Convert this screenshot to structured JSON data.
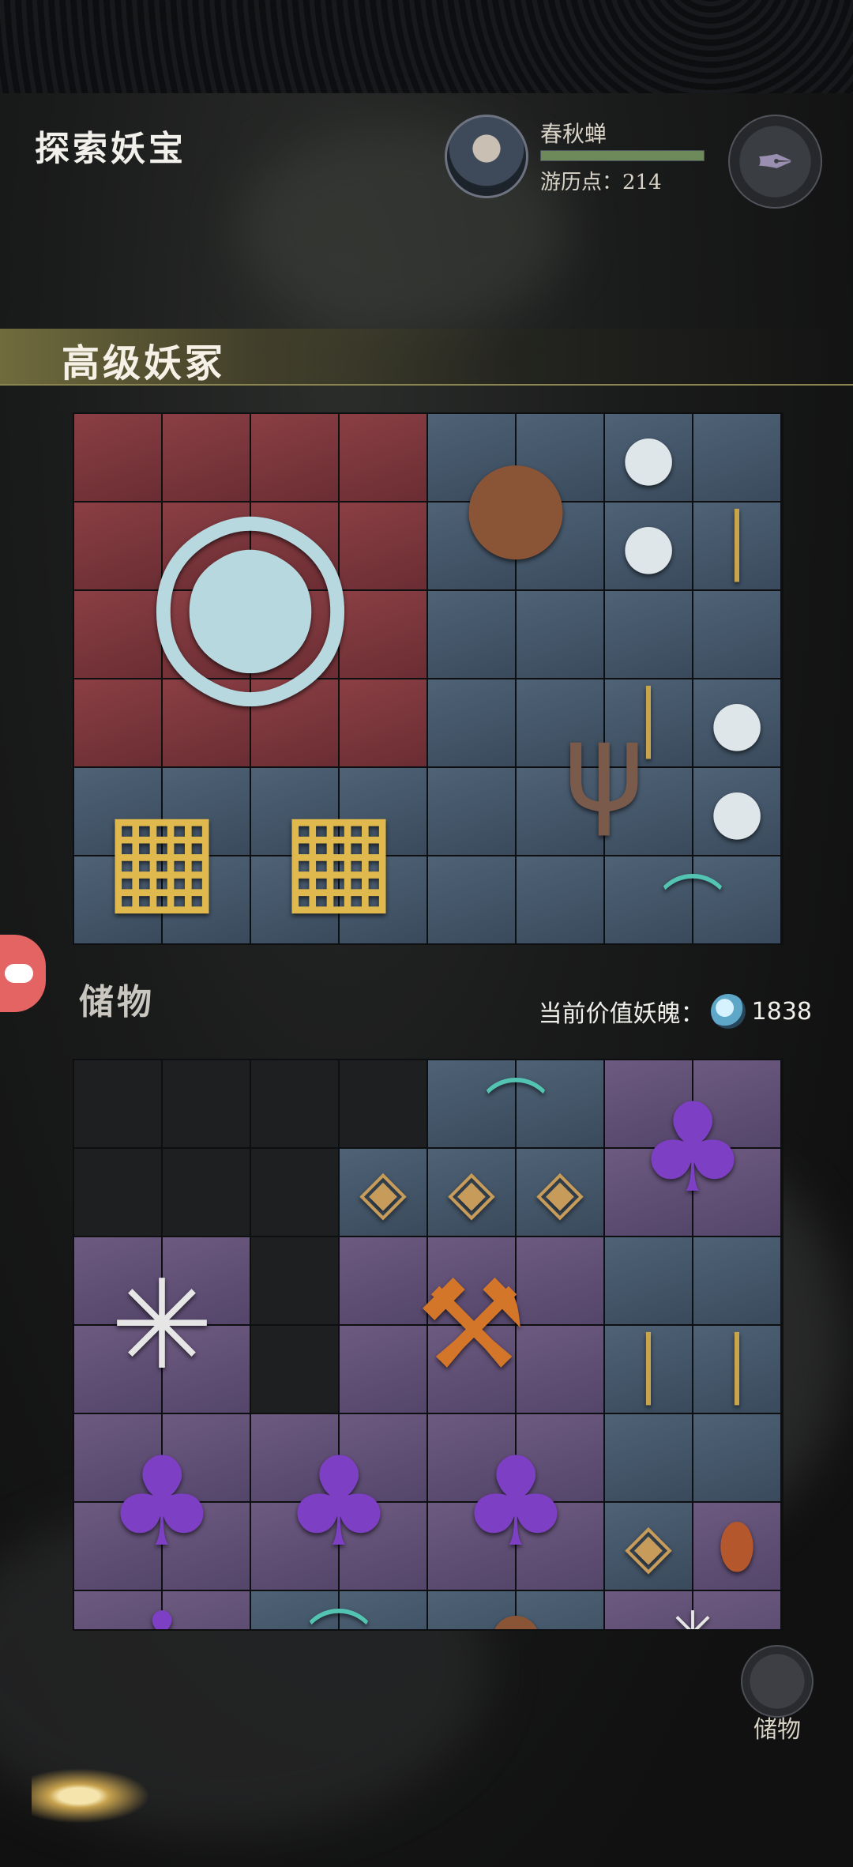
{
  "header": {
    "title": "探索妖宝",
    "player_name": "春秋蝉",
    "xp_progress": 1.0,
    "points_label": "游历点：",
    "points_value": "214"
  },
  "section": {
    "title": "高级妖冢"
  },
  "storage": {
    "label": "储物",
    "value_label": "当前价值妖魄：",
    "value": "1838",
    "bottom_button": "储物"
  },
  "icons": {
    "settings": "feather-icon",
    "soul": "soul-orb-icon",
    "side_tab": "gamepad-icon"
  },
  "colors": {
    "tile_red": "#7a353b",
    "tile_blue": "#44566a",
    "tile_purple": "#5f4f75",
    "accent_gold": "#c7a24e"
  },
  "treasure_grid": {
    "cols": 8,
    "rows": 6,
    "tiles": [
      "red",
      "red",
      "red",
      "red",
      "blue",
      "blue",
      "blue",
      "blue",
      "red",
      "red",
      "red",
      "red",
      "blue",
      "blue",
      "blue",
      "blue",
      "red",
      "red",
      "red",
      "red",
      "blue",
      "blue",
      "blue",
      "blue",
      "red",
      "red",
      "red",
      "red",
      "blue",
      "blue",
      "blue",
      "blue",
      "blue",
      "blue",
      "blue",
      "blue",
      "blue",
      "blue",
      "blue",
      "blue",
      "blue",
      "blue",
      "blue",
      "blue",
      "blue",
      "blue",
      "blue",
      "blue"
    ],
    "items": [
      {
        "name": "mirror-item",
        "glyph": "◉",
        "col": 0,
        "row": 0,
        "w": 4,
        "h": 4,
        "color": "#b8d8e0"
      },
      {
        "name": "bell-item",
        "glyph": "●",
        "col": 4,
        "row": 0,
        "w": 2,
        "h": 2,
        "color": "#8a5437"
      },
      {
        "name": "cocoon-item",
        "glyph": "●",
        "col": 6,
        "row": 0,
        "w": 1,
        "h": 1,
        "color": "#dfe6ea"
      },
      {
        "name": "coin-sword-item",
        "glyph": "│",
        "col": 7,
        "row": 0,
        "w": 1,
        "h": 3,
        "color": "#c9a44a"
      },
      {
        "name": "cocoon-item",
        "glyph": "●",
        "col": 6,
        "row": 1,
        "w": 1,
        "h": 1,
        "color": "#dfe6ea"
      },
      {
        "name": "trident-item",
        "glyph": "ψ",
        "col": 5,
        "row": 2,
        "w": 2,
        "h": 4,
        "color": "#7a5a4a"
      },
      {
        "name": "coin-sword-item",
        "glyph": "│",
        "col": 6,
        "row": 2,
        "w": 1,
        "h": 3,
        "color": "#c9a44a"
      },
      {
        "name": "cocoon-item",
        "glyph": "●",
        "col": 7,
        "row": 3,
        "w": 1,
        "h": 1,
        "color": "#dfe6ea"
      },
      {
        "name": "cocoon-item",
        "glyph": "●",
        "col": 7,
        "row": 4,
        "w": 1,
        "h": 1,
        "color": "#dfe6ea"
      },
      {
        "name": "compass-board-item",
        "glyph": "▦",
        "col": 0,
        "row": 4,
        "w": 2,
        "h": 2,
        "color": "#e0b94e"
      },
      {
        "name": "compass-board-item",
        "glyph": "▦",
        "col": 2,
        "row": 4,
        "w": 2,
        "h": 2,
        "color": "#e0b94e"
      },
      {
        "name": "jade-tooth-item",
        "glyph": "⌒",
        "col": 6,
        "row": 5,
        "w": 2,
        "h": 1,
        "color": "#53c3b2"
      }
    ]
  },
  "storage_grid": {
    "cols": 8,
    "rows": 7,
    "tiles": [
      "dark",
      "dark",
      "dark",
      "dark",
      "blue",
      "blue",
      "purple",
      "purple",
      "dark",
      "dark",
      "dark",
      "blue",
      "blue",
      "blue",
      "purple",
      "purple",
      "purple",
      "purple",
      "dark",
      "purple",
      "purple",
      "purple",
      "blue",
      "blue",
      "purple",
      "purple",
      "dark",
      "purple",
      "purple",
      "purple",
      "blue",
      "blue",
      "purple",
      "purple",
      "purple",
      "purple",
      "purple",
      "purple",
      "blue",
      "blue",
      "purple",
      "purple",
      "purple",
      "purple",
      "purple",
      "purple",
      "blue",
      "purple",
      "purple",
      "purple",
      "blue",
      "blue",
      "blue",
      "blue",
      "purple",
      "purple"
    ],
    "items": [
      {
        "name": "jade-tooth-item",
        "glyph": "⌒",
        "col": 4,
        "row": 0,
        "w": 2,
        "h": 1,
        "color": "#53c3b2"
      },
      {
        "name": "lingzhi-item",
        "glyph": "♣",
        "col": 6,
        "row": 0,
        "w": 2,
        "h": 2,
        "color": "#7d3fc4"
      },
      {
        "name": "talisman-item",
        "glyph": "◈",
        "col": 3,
        "row": 1,
        "w": 1,
        "h": 1,
        "color": "#c79b5a"
      },
      {
        "name": "talisman-item",
        "glyph": "◈",
        "col": 4,
        "row": 1,
        "w": 1,
        "h": 1,
        "color": "#c79b5a"
      },
      {
        "name": "talisman-item",
        "glyph": "◈",
        "col": 5,
        "row": 1,
        "w": 1,
        "h": 1,
        "color": "#c79b5a"
      },
      {
        "name": "spider-web-item",
        "glyph": "✳",
        "col": 0,
        "row": 2,
        "w": 2,
        "h": 2,
        "color": "#e6e6e6"
      },
      {
        "name": "fire-axe-item",
        "glyph": "⚒",
        "col": 3,
        "row": 2,
        "w": 3,
        "h": 2,
        "color": "#d4762a"
      },
      {
        "name": "coin-sword-item",
        "glyph": "│",
        "col": 6,
        "row": 2,
        "w": 1,
        "h": 3,
        "color": "#c9a44a"
      },
      {
        "name": "coin-sword-item",
        "glyph": "│",
        "col": 7,
        "row": 2,
        "w": 1,
        "h": 3,
        "color": "#c9a44a"
      },
      {
        "name": "lingzhi-item",
        "glyph": "♣",
        "col": 0,
        "row": 4,
        "w": 2,
        "h": 2,
        "color": "#7d3fc4"
      },
      {
        "name": "lingzhi-item",
        "glyph": "♣",
        "col": 2,
        "row": 4,
        "w": 2,
        "h": 2,
        "color": "#7d3fc4"
      },
      {
        "name": "lingzhi-item",
        "glyph": "♣",
        "col": 4,
        "row": 4,
        "w": 2,
        "h": 2,
        "color": "#7d3fc4"
      },
      {
        "name": "talisman-item",
        "glyph": "◈",
        "col": 6,
        "row": 5,
        "w": 1,
        "h": 1,
        "color": "#c79b5a"
      },
      {
        "name": "shuttle-item",
        "glyph": "⬮",
        "col": 7,
        "row": 5,
        "w": 1,
        "h": 1,
        "color": "#b5572c"
      },
      {
        "name": "lingzhi-item",
        "glyph": "♣",
        "col": 0,
        "row": 6,
        "w": 2,
        "h": 1,
        "color": "#7d3fc4"
      },
      {
        "name": "jade-tooth-item",
        "glyph": "⌒",
        "col": 2,
        "row": 6,
        "w": 2,
        "h": 1,
        "color": "#53c3b2"
      },
      {
        "name": "bell-item",
        "glyph": "●",
        "col": 4,
        "row": 6,
        "w": 2,
        "h": 1,
        "color": "#8a5437"
      },
      {
        "name": "spider-web-item",
        "glyph": "✳",
        "col": 6,
        "row": 6,
        "w": 2,
        "h": 1,
        "color": "#e6e6e6"
      }
    ]
  }
}
